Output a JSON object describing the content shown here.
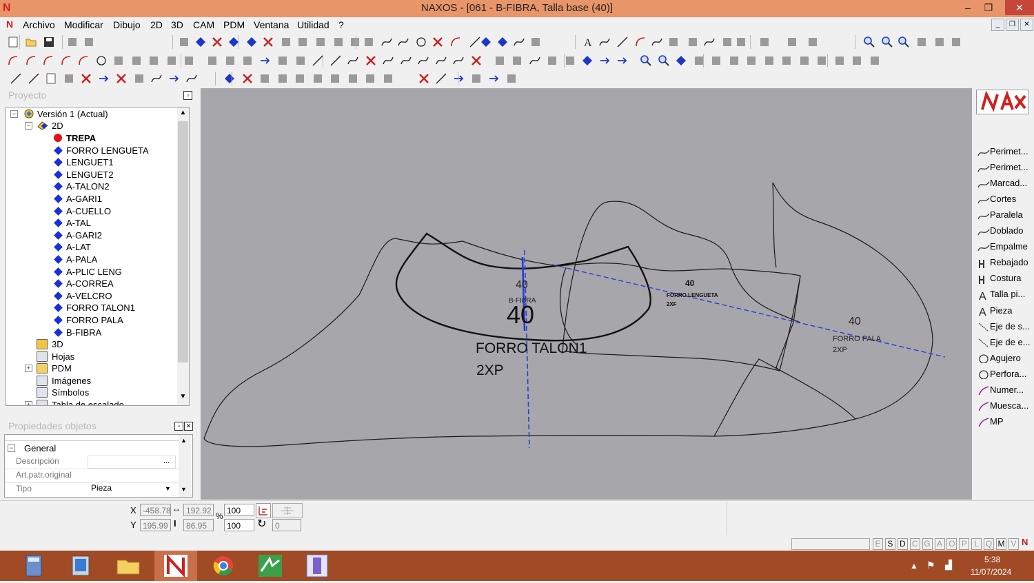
{
  "window": {
    "title": "NAXOS - [061 - B-FIBRA, Talla base (40)]",
    "minimize": "–",
    "restore": "❐",
    "close": "✕"
  },
  "menu": [
    "Archivo",
    "Modificar",
    "Dibujo",
    "2D",
    "3D",
    "CAM",
    "PDM",
    "Ventana",
    "Utilidad",
    "?"
  ],
  "project_panel": {
    "title": "Proyecto",
    "root": "Versión 1 (Actual)",
    "node_2d": "2D",
    "items": [
      "TREPA",
      "FORRO LENGUETA",
      "LENGUET1",
      "LENGUET2",
      "A-TALON2",
      "A-GARI1",
      "A-CUELLO",
      "A-TAL",
      "A-GARI2",
      "A-LAT",
      "A-PALA",
      "A-PLIC LENG",
      "A-CORREA",
      "A-VELCRO",
      "FORRO TALON1",
      "FORRO PALA",
      "B-FIBRA"
    ],
    "other_nodes": [
      "3D",
      "Hojas",
      "PDM",
      "Imágenes",
      "Símbolos",
      "Tabla de escalado"
    ]
  },
  "properties_panel": {
    "title": "Propiedades objetos",
    "group": "General",
    "rows": [
      {
        "label": "Descripción",
        "value": ""
      },
      {
        "label": "Art.patr.original",
        "value": ""
      },
      {
        "label": "Tipo",
        "value": "Pieza"
      }
    ]
  },
  "canvas": {
    "labels": {
      "bfibra_size": "40",
      "bfibra_name": "B-FIBRA",
      "big_size": "40",
      "talon_name": "FORRO TALON1",
      "talon_qty": "2XP",
      "lengueta_size": "40",
      "lengueta_name": "FORRO LENGUETA",
      "lengueta_qty": "2XF",
      "pala_size": "40",
      "pala_name": "FORRO PALA",
      "pala_qty": "2XP"
    }
  },
  "right_panel": {
    "logo": "NAXOS",
    "items": [
      "Perimet...",
      "Perimet...",
      "Marcad...",
      "Cortes",
      "Paralela",
      "Doblado",
      "Empalme",
      "Rebajado",
      "Costura",
      "Talla pi...",
      "Pieza",
      "Eje de s...",
      "Eje de e...",
      "Agujero",
      "Perfora...",
      "Numer...",
      "Muesca...",
      "MP"
    ]
  },
  "coords": {
    "x_label": "X",
    "y_label": "Y",
    "x": "-458.78",
    "y": "195.99",
    "width": "192.92",
    "height": "86.95",
    "percent_sign": "%",
    "scale_x": "100",
    "scale_y": "100",
    "rotation": "0"
  },
  "status": {
    "letters": [
      "E",
      "S",
      "D",
      "C",
      "G",
      "A",
      "O",
      "P",
      "L",
      "Q",
      "M",
      "V"
    ]
  },
  "taskbar": {
    "time": "5:38",
    "date": "11/07/2024"
  }
}
